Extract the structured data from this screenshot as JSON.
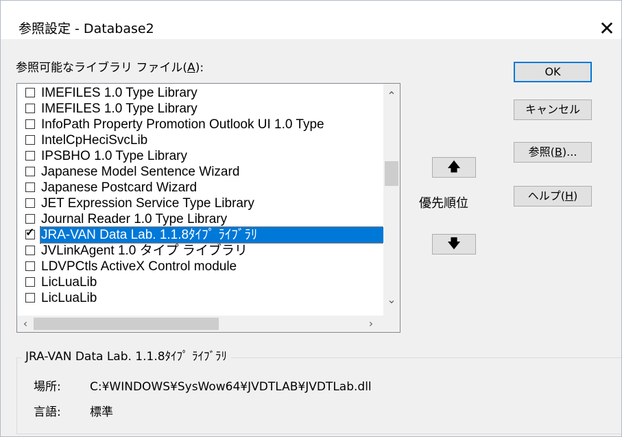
{
  "window": {
    "title": "参照設定 - Database2",
    "close_glyph": "✕"
  },
  "list": {
    "label_prefix": "参照可能なライブラリ ファイル(",
    "label_accel": "A",
    "label_suffix": "):",
    "items": [
      {
        "label": "IMEFILES 1.0 Type Library",
        "checked": false,
        "selected": false
      },
      {
        "label": "IMEFILES 1.0 Type Library",
        "checked": false,
        "selected": false
      },
      {
        "label": "InfoPath Property Promotion Outlook UI 1.0 Type",
        "checked": false,
        "selected": false
      },
      {
        "label": "IntelCpHeciSvcLib",
        "checked": false,
        "selected": false
      },
      {
        "label": "IPSBHO 1.0 Type Library",
        "checked": false,
        "selected": false
      },
      {
        "label": "Japanese Model Sentence Wizard",
        "checked": false,
        "selected": false
      },
      {
        "label": "Japanese Postcard Wizard",
        "checked": false,
        "selected": false
      },
      {
        "label": "JET Expression Service Type Library",
        "checked": false,
        "selected": false
      },
      {
        "label": "Journal Reader 1.0 Type Library",
        "checked": false,
        "selected": false
      },
      {
        "label": "JRA-VAN Data Lab. 1.1.8ﾀｲﾌﾟ ﾗｲﾌﾞﾗﾘ",
        "checked": true,
        "selected": true
      },
      {
        "label": "JVLinkAgent 1.0 タイプ ライブラリ",
        "checked": false,
        "selected": false
      },
      {
        "label": "LDVPCtls ActiveX Control module",
        "checked": false,
        "selected": false
      },
      {
        "label": "LicLuaLib",
        "checked": false,
        "selected": false
      },
      {
        "label": "LicLuaLib",
        "checked": false,
        "selected": false
      }
    ],
    "vscroll_up": "⌃",
    "vscroll_down": "⌄",
    "hscroll_left": "‹",
    "hscroll_right": "›"
  },
  "priority": {
    "up_glyph": "🡅",
    "down_glyph": "🡇",
    "label": "優先順位"
  },
  "buttons": {
    "ok": "OK",
    "cancel": "キャンセル",
    "browse_prefix": "参照(",
    "browse_accel": "B",
    "browse_suffix": ")...",
    "help_prefix": "ヘルプ(",
    "help_accel": "H",
    "help_suffix": ")"
  },
  "details": {
    "group_title": "JRA-VAN Data Lab. 1.1.8ﾀｲﾌﾟ ﾗｲﾌﾞﾗﾘ",
    "location_label": "場所:",
    "location_value": "C:¥WINDOWS¥SysWow64¥JVDTLAB¥JVDTLab.dll",
    "language_label": "言語:",
    "language_value": "標準"
  },
  "colors": {
    "selection": "#0078d7",
    "default_button_border": "#0078d7"
  }
}
